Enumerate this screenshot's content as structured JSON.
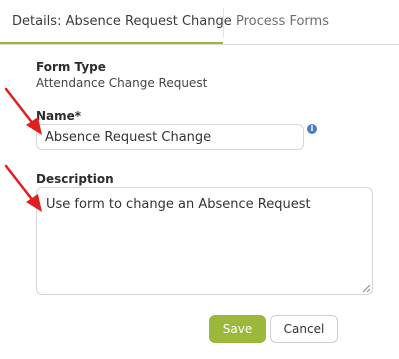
{
  "tabs": [
    {
      "label": "Details: Absence Request Change",
      "active": true
    },
    {
      "label": "Process Forms",
      "active": false
    }
  ],
  "form": {
    "form_type_label": "Form Type",
    "form_type_value": "Attendance Change Request",
    "name_label": "Name*",
    "name_value": "Absence Request Change",
    "description_label": "Description",
    "description_value": "Use form to change an Absence Request",
    "info_icon": "info-icon"
  },
  "actions": {
    "save_label": "Save",
    "cancel_label": "Cancel"
  },
  "colors": {
    "accent": "#9bb83a",
    "annotation_arrow": "#e02020",
    "info": "#4a7fc1"
  }
}
